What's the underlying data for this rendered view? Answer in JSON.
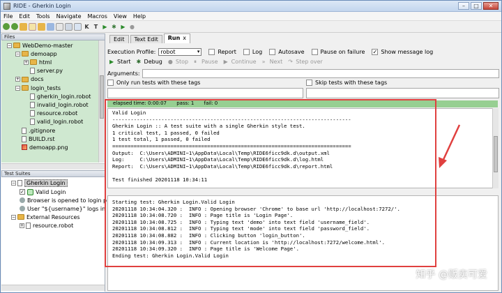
{
  "window": {
    "title": "RIDE - Gherkin Login"
  },
  "menu": [
    "File",
    "Edit",
    "Tools",
    "Navigate",
    "Macros",
    "View",
    "Help"
  ],
  "toolbar": {
    "k_label": "K",
    "t_label": "T"
  },
  "files_pane": {
    "header": "Files",
    "items": [
      {
        "label": "WebDemo-master",
        "type": "folder",
        "level": 0,
        "expand": "-"
      },
      {
        "label": "demoapp",
        "type": "folder",
        "level": 1,
        "expand": "-"
      },
      {
        "label": "html",
        "type": "folder",
        "level": 2,
        "expand": "+"
      },
      {
        "label": "server.py",
        "type": "file",
        "level": 2
      },
      {
        "label": "docs",
        "type": "folder",
        "level": 1,
        "expand": "+"
      },
      {
        "label": "login_tests",
        "type": "folder",
        "level": 1,
        "expand": "-"
      },
      {
        "label": "gherkin_login.robot",
        "type": "file",
        "level": 2
      },
      {
        "label": "invalid_login.robot",
        "type": "file",
        "level": 2
      },
      {
        "label": "resource.robot",
        "type": "file",
        "level": 2
      },
      {
        "label": "valid_login.robot",
        "type": "file",
        "level": 2
      },
      {
        "label": ".gitignore",
        "type": "file",
        "level": 1
      },
      {
        "label": "BUILD.rst",
        "type": "file",
        "level": 1
      },
      {
        "label": "demoapp.png",
        "type": "image",
        "level": 1
      }
    ]
  },
  "suites_pane": {
    "header": "Test Suites",
    "suite": "Gherkin Login",
    "testcase": "Valid Login",
    "keywords": [
      "Browser is opened to login pa",
      "User \"${username}\" logs in wi"
    ],
    "external": "External Resources",
    "resource": "resource.robot"
  },
  "tabs": [
    {
      "label": "Edit",
      "active": false
    },
    {
      "label": "Text Edit",
      "active": false
    },
    {
      "label": "Run",
      "active": true,
      "close": "x"
    }
  ],
  "run": {
    "execution_profile_label": "Execution Profile:",
    "profile": "robot",
    "report": "Report",
    "log": "Log",
    "autosave": "Autosave",
    "pause_on_failure": "Pause on failure",
    "show_message_log": "Show message log",
    "show_message_log_checked": "✓",
    "buttons": {
      "start": "Start",
      "debug": "Debug",
      "stop": "Stop",
      "pause": "Pause",
      "continue": "Continue",
      "next": "Next",
      "step_over": "Step over"
    },
    "arguments_label": "Arguments:",
    "only_run_tags": "Only run tests with these tags",
    "skip_tags": "Skip tests with these tags"
  },
  "status": {
    "elapsed": "elapsed time: 0:00:07",
    "pass": "pass: 1",
    "fail": "fail: 0"
  },
  "console_output": "Valid Login\n------------------------------------------------------------------------------\nGherkin Login :: A test suite with a single Gherkin style test.\n1 critical test, 1 passed, 0 failed\n1 test total, 1 passed, 0 failed\n==============================================================================\nOutput:  C:\\Users\\ADMINI~1\\AppData\\Local\\Temp\\RIDE6ficc9dk.d\\output.xml\nLog:     C:\\Users\\ADMINI~1\\AppData\\Local\\Temp\\RIDE6ficc9dk.d\\log.html\nReport:  C:\\Users\\ADMINI~1\\AppData\\Local\\Temp\\RIDE6ficc9dk.d\\report.html\n\nTest finished 20201118 10:34:11",
  "message_log": "Starting test: Gherkin Login.Valid Login\n20201118 10:34:04.320 :  INFO : Opening browser 'Chrome' to base url 'http://localhost:7272/'.\n20201118 10:34:08.720 :  INFO : Page title is 'Login Page'.\n20201118 10:34:08.725 :  INFO : Typing text 'demo' into text field 'username_field'.\n20201118 10:34:08.812 :  INFO : Typing text 'mode' into text field 'password_field'.\n20201118 10:34:08.882 :  INFO : Clicking button 'login_button'.\n20201118 10:34:09.313 :  INFO : Current location is 'http://localhost:7272/welcome.html'.\n20201118 10:34:09.320 :  INFO : Page title is 'Welcome Page'.\nEnding test: Gherkin Login.Valid Login",
  "watermark": "知乎 @贩卖可爱",
  "colors": {
    "files_bg": "#cfe8d0",
    "status_bg": "#97cf92",
    "annotation_red": "#e0403f"
  }
}
